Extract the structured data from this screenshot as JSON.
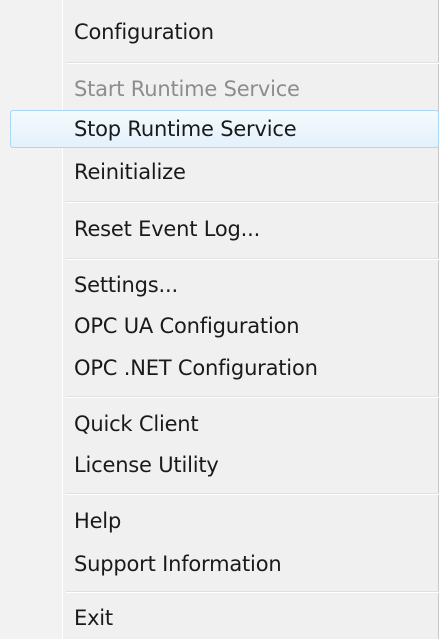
{
  "menu": {
    "items": [
      {
        "label": "Configuration"
      },
      {
        "label": "Start Runtime Service"
      },
      {
        "label": "Stop Runtime Service"
      },
      {
        "label": "Reinitialize"
      },
      {
        "label": "Reset Event Log..."
      },
      {
        "label": "Settings..."
      },
      {
        "label": "OPC UA Configuration"
      },
      {
        "label": "OPC .NET Configuration"
      },
      {
        "label": "Quick Client"
      },
      {
        "label": "License Utility"
      },
      {
        "label": "Help"
      },
      {
        "label": "Support Information"
      },
      {
        "label": "Exit"
      }
    ],
    "disabled_item": "Start Runtime Service",
    "highlighted_item": "Stop Runtime Service"
  }
}
